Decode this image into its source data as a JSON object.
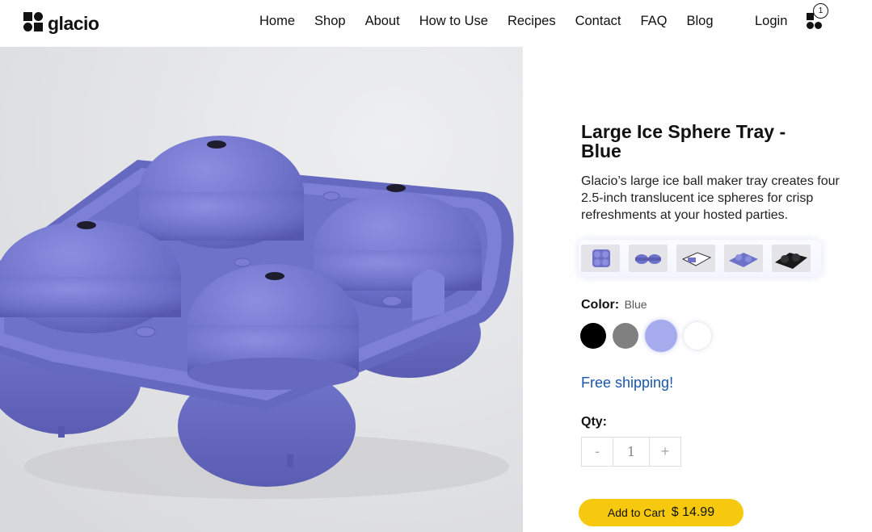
{
  "brand": {
    "name": "glacio"
  },
  "nav": {
    "items": [
      {
        "label": "Home"
      },
      {
        "label": "Shop"
      },
      {
        "label": "About"
      },
      {
        "label": "How to Use"
      },
      {
        "label": "Recipes"
      },
      {
        "label": "Contact"
      },
      {
        "label": "FAQ"
      },
      {
        "label": "Blog"
      }
    ],
    "login_label": "Login",
    "cart_count": "1"
  },
  "product": {
    "title": "Large Ice Sphere Tray - Blue",
    "description": "Glacio’s large ice ball maker tray creates four 2.5-inch translucent ice spheres for crisp refreshments at your hosted parties.",
    "color_label": "Color:",
    "color_value": "Blue",
    "swatch_colors": [
      "#000000",
      "#808080",
      "#a5abed",
      "#ffffff"
    ],
    "shipping": "Free shipping!",
    "qty_label": "Qty:",
    "qty_minus": "-",
    "qty_value": "1",
    "qty_plus": "+",
    "cart_label": "Add to Cart",
    "price": "$ 14.99"
  },
  "colors": {
    "accent_yellow": "#f6c90e",
    "link_blue": "#1a56b0",
    "tray_blue": "#6f72c9"
  }
}
